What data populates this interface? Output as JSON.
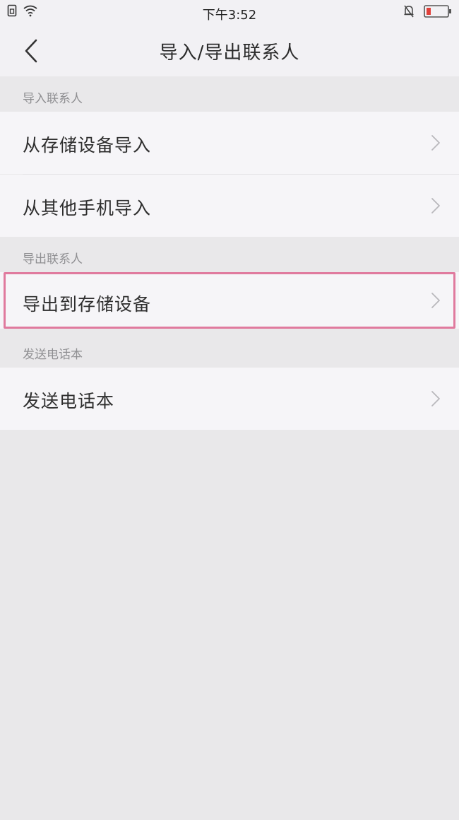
{
  "status_bar": {
    "time": "下午3:52",
    "icons": [
      "sim-icon",
      "wifi-icon",
      "mute-bell-icon",
      "battery-low-icon"
    ],
    "battery_color": "#e0403a"
  },
  "nav": {
    "back_icon": "chevron-left-icon",
    "title": "导入/导出联系人"
  },
  "sections": [
    {
      "header": "导入联系人",
      "items": [
        {
          "label": "从存储设备导入",
          "icon": "chevron-right-icon"
        },
        {
          "label": "从其他手机导入",
          "icon": "chevron-right-icon"
        }
      ]
    },
    {
      "header": "导出联系人",
      "items": [
        {
          "label": "导出到存储设备",
          "icon": "chevron-right-icon",
          "highlighted": true
        }
      ]
    },
    {
      "header": "发送电话本",
      "items": [
        {
          "label": "发送电话本",
          "icon": "chevron-right-icon"
        }
      ]
    }
  ],
  "colors": {
    "background": "#e9e8ea",
    "row_background": "#f6f5f8",
    "highlight_border": "#e07a9e",
    "header_text": "#8f8f92"
  }
}
